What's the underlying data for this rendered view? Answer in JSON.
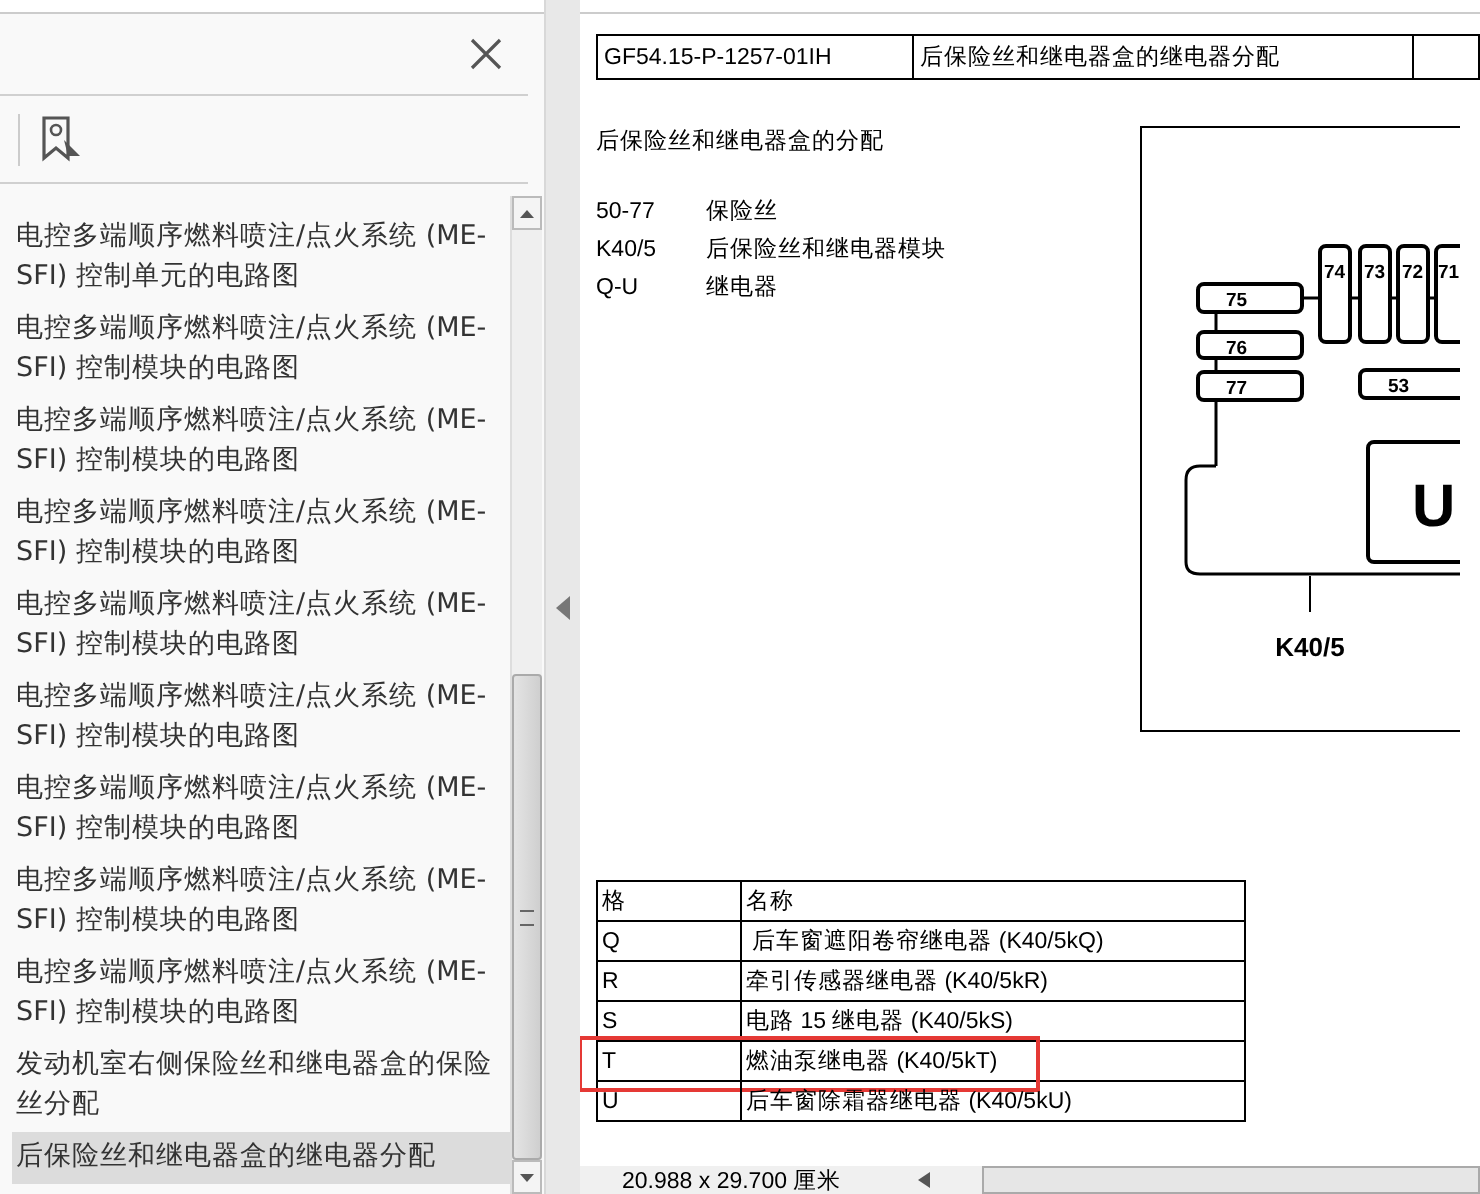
{
  "nav_panel": {
    "items": [
      {
        "label": "电控多端顺序燃料喷注/点火系统 (ME-SFI) 控制单元的电路图",
        "selected": false
      },
      {
        "label": "电控多端顺序燃料喷注/点火系统 (ME-SFI) 控制模块的电路图",
        "selected": false
      },
      {
        "label": "电控多端顺序燃料喷注/点火系统 (ME-SFI) 控制模块的电路图",
        "selected": false
      },
      {
        "label": "电控多端顺序燃料喷注/点火系统 (ME-SFI) 控制模块的电路图",
        "selected": false
      },
      {
        "label": "电控多端顺序燃料喷注/点火系统 (ME-SFI) 控制模块的电路图",
        "selected": false
      },
      {
        "label": "电控多端顺序燃料喷注/点火系统 (ME-SFI) 控制模块的电路图",
        "selected": false
      },
      {
        "label": "电控多端顺序燃料喷注/点火系统 (ME-SFI) 控制模块的电路图",
        "selected": false
      },
      {
        "label": "电控多端顺序燃料喷注/点火系统 (ME-SFI) 控制模块的电路图",
        "selected": false
      },
      {
        "label": "电控多端顺序燃料喷注/点火系统 (ME-SFI) 控制模块的电路图",
        "selected": false
      },
      {
        "label": "发动机室右侧保险丝和继电器盒的保险丝分配",
        "selected": false
      },
      {
        "label": "后保险丝和继电器盒的继电器分配",
        "selected": true
      }
    ]
  },
  "document": {
    "header": [
      "GF54.15-P-1257-01IH",
      "后保险丝和继电器盒的继电器分配"
    ],
    "heading": "后保险丝和继电器盒的分配",
    "legend": [
      {
        "code": "50-77",
        "text": "保险丝"
      },
      {
        "code": "K40/5",
        "text": "后保险丝和继电器模块"
      },
      {
        "code": "Q-U",
        "text": "继电器"
      }
    ],
    "diagram": {
      "fuse_labels": [
        "74",
        "73",
        "72",
        "71",
        "75",
        "76",
        "77",
        "53"
      ],
      "relay_label": "U",
      "module_label": "K40/5"
    },
    "table": {
      "columns": [
        "格",
        "名称"
      ],
      "rows": [
        {
          "cells": [
            "Q",
            " 后车窗遮阳卷帘继电器 (K40/5kQ)"
          ],
          "highlighted": false
        },
        {
          "cells": [
            "R",
            "牵引传感器继电器 (K40/5kR)"
          ],
          "highlighted": false
        },
        {
          "cells": [
            "S",
            "电路 15 继电器 (K40/5kS)"
          ],
          "highlighted": false
        },
        {
          "cells": [
            "T",
            "燃油泵继电器 (K40/5kT)"
          ],
          "highlighted": true
        },
        {
          "cells": [
            "U",
            "后车窗除霜器继电器 (K40/5kU)"
          ],
          "highlighted": false
        }
      ]
    }
  },
  "status_bar": {
    "page_size": "20.988 x 29.700 厘米"
  }
}
